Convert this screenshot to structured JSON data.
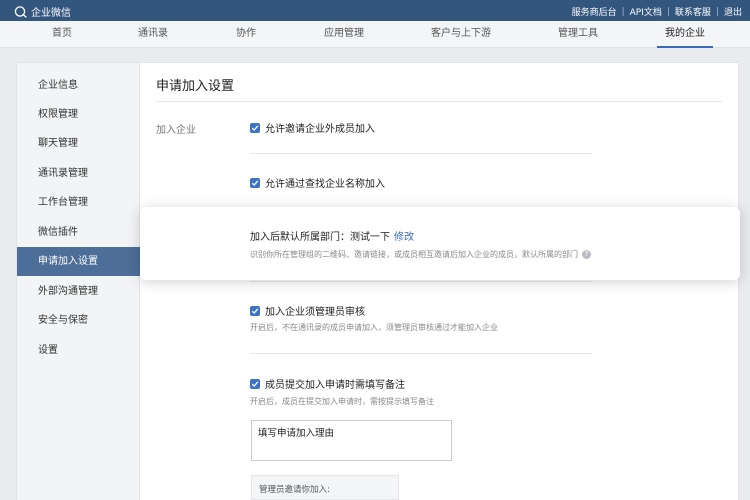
{
  "app": {
    "name": "企业微信"
  },
  "top_links": [
    "服务商后台",
    "API文档",
    "联系客服",
    "退出"
  ],
  "nav": {
    "items": [
      {
        "label": "首页"
      },
      {
        "label": "通讯录"
      },
      {
        "label": "协作"
      },
      {
        "label": "应用管理"
      },
      {
        "label": "客户与上下游"
      },
      {
        "label": "管理工具"
      },
      {
        "label": "我的企业"
      }
    ],
    "active": "我的企业"
  },
  "sidebar": {
    "items": [
      {
        "label": "企业信息"
      },
      {
        "label": "权限管理"
      },
      {
        "label": "聊天管理"
      },
      {
        "label": "通讯录管理"
      },
      {
        "label": "工作台管理"
      },
      {
        "label": "微信插件"
      },
      {
        "label": "申请加入设置"
      },
      {
        "label": "外部沟通管理"
      },
      {
        "label": "安全与保密"
      },
      {
        "label": "设置"
      }
    ],
    "active": "申请加入设置"
  },
  "main": {
    "title": "申请加入设置",
    "section_label": "加入企业",
    "options": {
      "allow_invite": "允许邀请企业外成员加入",
      "allow_search": "允许通过查找企业名称加入",
      "admin_review": "加入企业须管理员审核",
      "admin_review_hint": "开启后，不在通讯录的成员申请加入，须管理员审核通过才能加入企业",
      "require_note": "成员提交加入申请时需填写备注",
      "require_note_hint": "开启后，成员在提交加入申请时，需按提示填写备注"
    },
    "textarea_value": "填写申请加入理由",
    "invite_label": "管理员邀请你加入:"
  },
  "highlight": {
    "line1": "加入后默认所属部门：测试一下",
    "modify": "修改",
    "line2": "识别你所在管理组的二维码、邀请链接，或成员相互邀请后加入企业的成员，默认所属的部门",
    "help_icon": "?"
  },
  "colors": {
    "topbar": "#33567e",
    "accent": "#3f74c5",
    "sidebar_active": "#4d6e98",
    "link": "#3a6ab2"
  }
}
